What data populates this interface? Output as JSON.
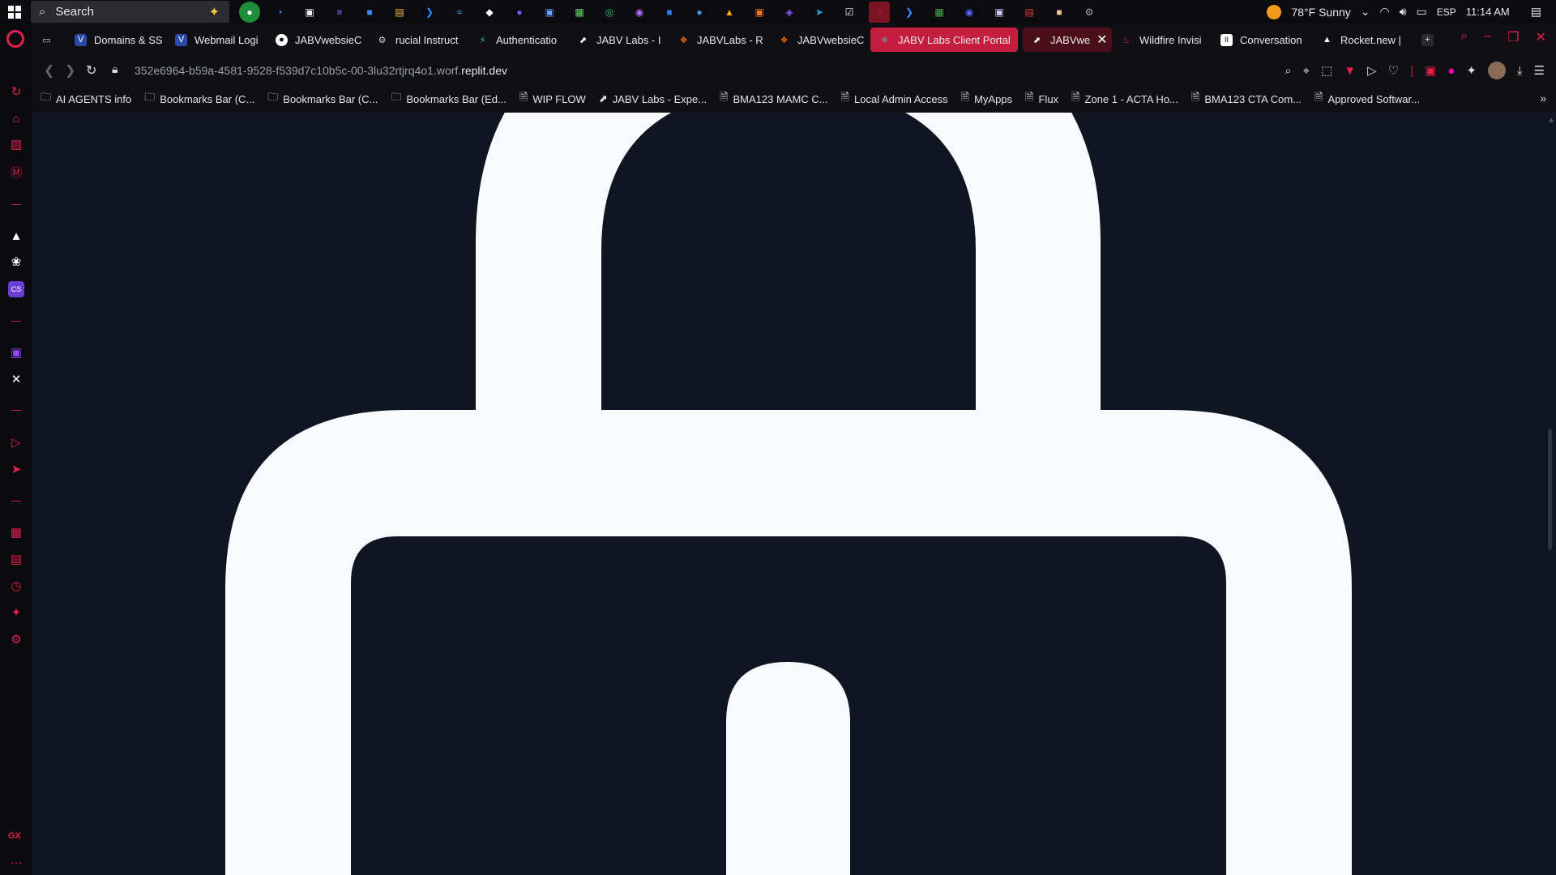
{
  "taskbar": {
    "search_label": "Search",
    "weather": "78°F  Sunny",
    "language": "ESP",
    "time": "11:14 AM"
  },
  "tabs": [
    {
      "label": "Domains & SS",
      "icon": "vercel-icon",
      "color": "#2b4aa8"
    },
    {
      "label": "Webmail Logi",
      "icon": "vercel-icon",
      "color": "#2b4aa8"
    },
    {
      "label": "JABVwebsieC",
      "icon": "github-icon",
      "color": "#ffffff"
    },
    {
      "label": "rucial Instruct",
      "icon": "gear-icon",
      "color": "#cccccc"
    },
    {
      "label": "Authenticatio",
      "icon": "bolt-icon",
      "color": "#3ecf8e"
    },
    {
      "label": "JABV Labs - I",
      "icon": "replit-icon",
      "color": "#ffffff"
    },
    {
      "label": "JABVLabs - R",
      "icon": "replit-icon",
      "color": "#f26207"
    },
    {
      "label": "JABVwebsieC",
      "icon": "replit-icon",
      "color": "#f26207"
    },
    {
      "label": "JABV Labs Client Portal",
      "icon": "react-icon",
      "color": "#61dafb"
    },
    {
      "label": "JABVwe",
      "icon": "replit-icon",
      "color": "#ffffff"
    },
    {
      "label": "Wildfire Invisi",
      "icon": "flame-icon",
      "color": "#e0224b"
    },
    {
      "label": "Conversation",
      "icon": "chat-icon",
      "color": "#ffffff"
    },
    {
      "label": "Rocket.new |",
      "icon": "rocket-icon",
      "color": "#ffffff"
    }
  ],
  "address": {
    "url_prefix": "352e6964-b59a-4581-9528-f539d7c10b5c-00-3lu32rtjrq4o1.worf.",
    "url_host": "replit.dev"
  },
  "bookmarks": [
    {
      "label": "AI AGENTS info",
      "icon": "folder-icon"
    },
    {
      "label": "Bookmarks Bar (C...",
      "icon": "folder-icon"
    },
    {
      "label": "Bookmarks Bar (C...",
      "icon": "folder-icon"
    },
    {
      "label": "Bookmarks Bar (Ed...",
      "icon": "folder-icon"
    },
    {
      "label": "WIP FLOW",
      "icon": "page-icon"
    },
    {
      "label": "JABV Labs - Expe...",
      "icon": "replit-icon"
    },
    {
      "label": "BMA123 MAMC C...",
      "icon": "page-icon"
    },
    {
      "label": "Local Admin Access",
      "icon": "page-icon"
    },
    {
      "label": "MyApps",
      "icon": "page-icon"
    },
    {
      "label": "Flux",
      "icon": "page-icon"
    },
    {
      "label": "Zone 1 - ACTA Ho...",
      "icon": "page-icon"
    },
    {
      "label": "BMA123 CTA Com...",
      "icon": "page-icon"
    },
    {
      "label": "Approved Softwar...",
      "icon": "page-icon"
    }
  ],
  "sidebar": {
    "footer_label": "GX"
  },
  "content": {
    "graphic": "lock-icon",
    "background": "#0f1521",
    "graphic_color": "#f8fafc"
  }
}
